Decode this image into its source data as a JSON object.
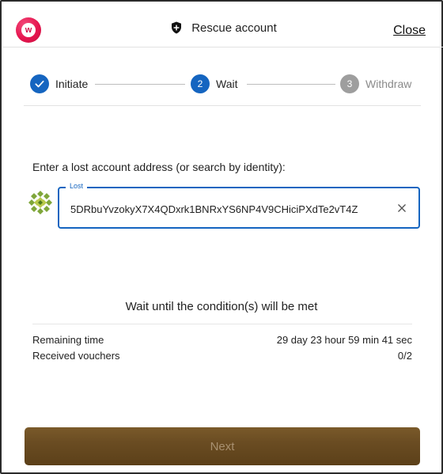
{
  "header": {
    "title": "Rescue account",
    "close_label": "Close",
    "logo_letter": "w"
  },
  "stepper": {
    "steps": [
      {
        "number": "1",
        "label": "Initiate",
        "state": "done"
      },
      {
        "number": "2",
        "label": "Wait",
        "state": "active"
      },
      {
        "number": "3",
        "label": "Withdraw",
        "state": "pending"
      }
    ]
  },
  "lost_account": {
    "prompt": "Enter a lost account address (or search by identity):",
    "field_label": "Lost",
    "value": "5DRbuYvzokyX7X4QDxrk1BNRxYS6NP4V9CHiciPXdTe2vT4Z"
  },
  "wait": {
    "title": "Wait until the condition(s) will be met",
    "rows": [
      {
        "label": "Remaining time",
        "value": "29 day 23 hour 59 min 41 sec"
      },
      {
        "label": "Received vouchers",
        "value": "0/2"
      }
    ]
  },
  "actions": {
    "next_label": "Next"
  },
  "colors": {
    "accent": "#1565c0",
    "pending": "#9e9e9e",
    "logo": "#e6154f",
    "next_button": "#6a4c22"
  }
}
